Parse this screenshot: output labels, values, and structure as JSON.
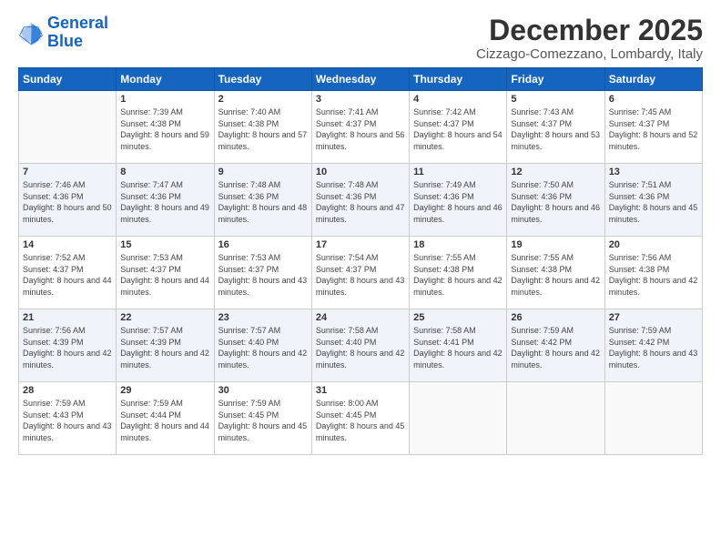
{
  "logo": {
    "line1": "General",
    "line2": "Blue"
  },
  "title": "December 2025",
  "subtitle": "Cizzago-Comezzano, Lombardy, Italy",
  "weekdays": [
    "Sunday",
    "Monday",
    "Tuesday",
    "Wednesday",
    "Thursday",
    "Friday",
    "Saturday"
  ],
  "weeks": [
    [
      {
        "day": "",
        "sunrise": "",
        "sunset": "",
        "daylight": ""
      },
      {
        "day": "1",
        "sunrise": "Sunrise: 7:39 AM",
        "sunset": "Sunset: 4:38 PM",
        "daylight": "Daylight: 8 hours and 59 minutes."
      },
      {
        "day": "2",
        "sunrise": "Sunrise: 7:40 AM",
        "sunset": "Sunset: 4:38 PM",
        "daylight": "Daylight: 8 hours and 57 minutes."
      },
      {
        "day": "3",
        "sunrise": "Sunrise: 7:41 AM",
        "sunset": "Sunset: 4:37 PM",
        "daylight": "Daylight: 8 hours and 56 minutes."
      },
      {
        "day": "4",
        "sunrise": "Sunrise: 7:42 AM",
        "sunset": "Sunset: 4:37 PM",
        "daylight": "Daylight: 8 hours and 54 minutes."
      },
      {
        "day": "5",
        "sunrise": "Sunrise: 7:43 AM",
        "sunset": "Sunset: 4:37 PM",
        "daylight": "Daylight: 8 hours and 53 minutes."
      },
      {
        "day": "6",
        "sunrise": "Sunrise: 7:45 AM",
        "sunset": "Sunset: 4:37 PM",
        "daylight": "Daylight: 8 hours and 52 minutes."
      }
    ],
    [
      {
        "day": "7",
        "sunrise": "Sunrise: 7:46 AM",
        "sunset": "Sunset: 4:36 PM",
        "daylight": "Daylight: 8 hours and 50 minutes."
      },
      {
        "day": "8",
        "sunrise": "Sunrise: 7:47 AM",
        "sunset": "Sunset: 4:36 PM",
        "daylight": "Daylight: 8 hours and 49 minutes."
      },
      {
        "day": "9",
        "sunrise": "Sunrise: 7:48 AM",
        "sunset": "Sunset: 4:36 PM",
        "daylight": "Daylight: 8 hours and 48 minutes."
      },
      {
        "day": "10",
        "sunrise": "Sunrise: 7:48 AM",
        "sunset": "Sunset: 4:36 PM",
        "daylight": "Daylight: 8 hours and 47 minutes."
      },
      {
        "day": "11",
        "sunrise": "Sunrise: 7:49 AM",
        "sunset": "Sunset: 4:36 PM",
        "daylight": "Daylight: 8 hours and 46 minutes."
      },
      {
        "day": "12",
        "sunrise": "Sunrise: 7:50 AM",
        "sunset": "Sunset: 4:36 PM",
        "daylight": "Daylight: 8 hours and 46 minutes."
      },
      {
        "day": "13",
        "sunrise": "Sunrise: 7:51 AM",
        "sunset": "Sunset: 4:36 PM",
        "daylight": "Daylight: 8 hours and 45 minutes."
      }
    ],
    [
      {
        "day": "14",
        "sunrise": "Sunrise: 7:52 AM",
        "sunset": "Sunset: 4:37 PM",
        "daylight": "Daylight: 8 hours and 44 minutes."
      },
      {
        "day": "15",
        "sunrise": "Sunrise: 7:53 AM",
        "sunset": "Sunset: 4:37 PM",
        "daylight": "Daylight: 8 hours and 44 minutes."
      },
      {
        "day": "16",
        "sunrise": "Sunrise: 7:53 AM",
        "sunset": "Sunset: 4:37 PM",
        "daylight": "Daylight: 8 hours and 43 minutes."
      },
      {
        "day": "17",
        "sunrise": "Sunrise: 7:54 AM",
        "sunset": "Sunset: 4:37 PM",
        "daylight": "Daylight: 8 hours and 43 minutes."
      },
      {
        "day": "18",
        "sunrise": "Sunrise: 7:55 AM",
        "sunset": "Sunset: 4:38 PM",
        "daylight": "Daylight: 8 hours and 42 minutes."
      },
      {
        "day": "19",
        "sunrise": "Sunrise: 7:55 AM",
        "sunset": "Sunset: 4:38 PM",
        "daylight": "Daylight: 8 hours and 42 minutes."
      },
      {
        "day": "20",
        "sunrise": "Sunrise: 7:56 AM",
        "sunset": "Sunset: 4:38 PM",
        "daylight": "Daylight: 8 hours and 42 minutes."
      }
    ],
    [
      {
        "day": "21",
        "sunrise": "Sunrise: 7:56 AM",
        "sunset": "Sunset: 4:39 PM",
        "daylight": "Daylight: 8 hours and 42 minutes."
      },
      {
        "day": "22",
        "sunrise": "Sunrise: 7:57 AM",
        "sunset": "Sunset: 4:39 PM",
        "daylight": "Daylight: 8 hours and 42 minutes."
      },
      {
        "day": "23",
        "sunrise": "Sunrise: 7:57 AM",
        "sunset": "Sunset: 4:40 PM",
        "daylight": "Daylight: 8 hours and 42 minutes."
      },
      {
        "day": "24",
        "sunrise": "Sunrise: 7:58 AM",
        "sunset": "Sunset: 4:40 PM",
        "daylight": "Daylight: 8 hours and 42 minutes."
      },
      {
        "day": "25",
        "sunrise": "Sunrise: 7:58 AM",
        "sunset": "Sunset: 4:41 PM",
        "daylight": "Daylight: 8 hours and 42 minutes."
      },
      {
        "day": "26",
        "sunrise": "Sunrise: 7:59 AM",
        "sunset": "Sunset: 4:42 PM",
        "daylight": "Daylight: 8 hours and 42 minutes."
      },
      {
        "day": "27",
        "sunrise": "Sunrise: 7:59 AM",
        "sunset": "Sunset: 4:42 PM",
        "daylight": "Daylight: 8 hours and 43 minutes."
      }
    ],
    [
      {
        "day": "28",
        "sunrise": "Sunrise: 7:59 AM",
        "sunset": "Sunset: 4:43 PM",
        "daylight": "Daylight: 8 hours and 43 minutes."
      },
      {
        "day": "29",
        "sunrise": "Sunrise: 7:59 AM",
        "sunset": "Sunset: 4:44 PM",
        "daylight": "Daylight: 8 hours and 44 minutes."
      },
      {
        "day": "30",
        "sunrise": "Sunrise: 7:59 AM",
        "sunset": "Sunset: 4:45 PM",
        "daylight": "Daylight: 8 hours and 45 minutes."
      },
      {
        "day": "31",
        "sunrise": "Sunrise: 8:00 AM",
        "sunset": "Sunset: 4:45 PM",
        "daylight": "Daylight: 8 hours and 45 minutes."
      },
      {
        "day": "",
        "sunrise": "",
        "sunset": "",
        "daylight": ""
      },
      {
        "day": "",
        "sunrise": "",
        "sunset": "",
        "daylight": ""
      },
      {
        "day": "",
        "sunrise": "",
        "sunset": "",
        "daylight": ""
      }
    ]
  ]
}
